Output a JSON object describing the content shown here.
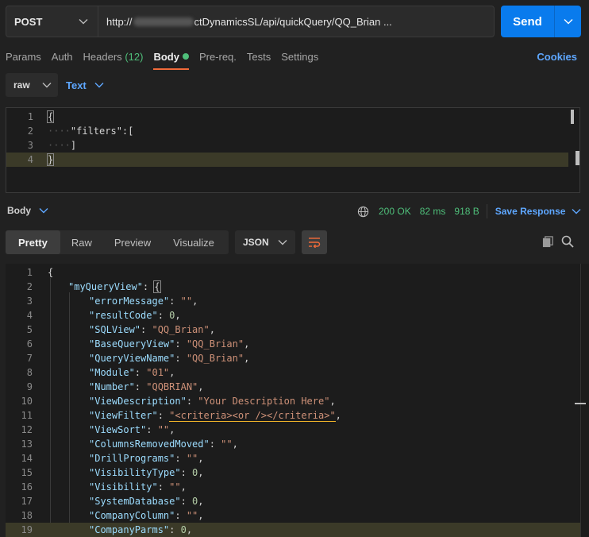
{
  "request": {
    "method": "POST",
    "url_prefix": "http://",
    "url_suffix": "ctDynamicsSL/api/quickQuery/QQ_Brian ...",
    "send_label": "Send"
  },
  "request_tabs": [
    {
      "label": "Params"
    },
    {
      "label": "Auth"
    },
    {
      "label": "Headers",
      "count": "(12)"
    },
    {
      "label": "Body",
      "active": true
    },
    {
      "label": "Pre-req."
    },
    {
      "label": "Tests"
    },
    {
      "label": "Settings"
    }
  ],
  "cookies_label": "Cookies",
  "body_mode": "raw",
  "body_format": "Text",
  "request_body": [
    {
      "n": "1",
      "dots": "",
      "text": "{"
    },
    {
      "n": "2",
      "dots": "····",
      "text": "\"filters\":["
    },
    {
      "n": "3",
      "dots": "····",
      "text": "]"
    },
    {
      "n": "4",
      "dots": "",
      "text": "}"
    }
  ],
  "response": {
    "body_label": "Body",
    "status": "200 OK",
    "time": "82 ms",
    "size": "918 B",
    "save_label": "Save Response",
    "tabs": [
      "Pretty",
      "Raw",
      "Preview",
      "Visualize"
    ],
    "active_tab": "Pretty",
    "format": "JSON"
  },
  "colors": {
    "accent": "#097bed",
    "status_ok": "#4fbf7a",
    "active_tab_underline": "#f26b3a",
    "link": "#5ea7ff"
  },
  "icons": [
    "chevron-down-icon",
    "globe-icon",
    "wrap-lines-icon",
    "copy-icon",
    "search-icon"
  ],
  "response_body": [
    {
      "n": "1",
      "indent": 0,
      "k": "",
      "v": "",
      "vt": "",
      "tail": "{"
    },
    {
      "n": "2",
      "indent": 1,
      "k": "\"myQueryView\"",
      "v": "",
      "vt": "",
      "tail": "{"
    },
    {
      "n": "3",
      "indent": 2,
      "k": "\"errorMessage\"",
      "v": "\"\"",
      "vt": "s",
      "tail": ","
    },
    {
      "n": "4",
      "indent": 2,
      "k": "\"resultCode\"",
      "v": "0",
      "vt": "n",
      "tail": ","
    },
    {
      "n": "5",
      "indent": 2,
      "k": "\"SQLView\"",
      "v": "\"QQ_Brian\"",
      "vt": "s",
      "tail": ","
    },
    {
      "n": "6",
      "indent": 2,
      "k": "\"BaseQueryView\"",
      "v": "\"QQ_Brian\"",
      "vt": "s",
      "tail": ","
    },
    {
      "n": "7",
      "indent": 2,
      "k": "\"QueryViewName\"",
      "v": "\"QQ_Brian\"",
      "vt": "s",
      "tail": ","
    },
    {
      "n": "8",
      "indent": 2,
      "k": "\"Module\"",
      "v": "\"01\"",
      "vt": "s",
      "tail": ","
    },
    {
      "n": "9",
      "indent": 2,
      "k": "\"Number\"",
      "v": "\"QQBRIAN\"",
      "vt": "s",
      "tail": ","
    },
    {
      "n": "10",
      "indent": 2,
      "k": "\"ViewDescription\"",
      "v": "\"Your Description Here\"",
      "vt": "s",
      "tail": ","
    },
    {
      "n": "11",
      "indent": 2,
      "k": "\"ViewFilter\"",
      "v": "\"<criteria><or /></criteria>\"",
      "vt": "s",
      "tail": ","
    },
    {
      "n": "12",
      "indent": 2,
      "k": "\"ViewSort\"",
      "v": "\"\"",
      "vt": "s",
      "tail": ","
    },
    {
      "n": "13",
      "indent": 2,
      "k": "\"ColumnsRemovedMoved\"",
      "v": "\"\"",
      "vt": "s",
      "tail": ","
    },
    {
      "n": "14",
      "indent": 2,
      "k": "\"DrillPrograms\"",
      "v": "\"\"",
      "vt": "s",
      "tail": ","
    },
    {
      "n": "15",
      "indent": 2,
      "k": "\"VisibilityType\"",
      "v": "0",
      "vt": "n",
      "tail": ","
    },
    {
      "n": "16",
      "indent": 2,
      "k": "\"Visibility\"",
      "v": "\"\"",
      "vt": "s",
      "tail": ","
    },
    {
      "n": "17",
      "indent": 2,
      "k": "\"SystemDatabase\"",
      "v": "0",
      "vt": "n",
      "tail": ","
    },
    {
      "n": "18",
      "indent": 2,
      "k": "\"CompanyColumn\"",
      "v": "\"\"",
      "vt": "s",
      "tail": ","
    },
    {
      "n": "19",
      "indent": 2,
      "k": "\"CompanyParms\"",
      "v": "0",
      "vt": "n",
      "tail": ","
    }
  ]
}
